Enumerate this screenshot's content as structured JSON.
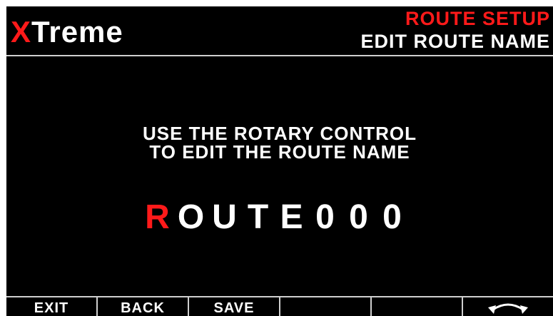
{
  "header": {
    "logo_first": "X",
    "logo_rest": "Treme",
    "category": "ROUTE SETUP",
    "title": "EDIT ROUTE NAME"
  },
  "instructions": {
    "line1": "USE THE ROTARY CONTROL",
    "line2": "TO EDIT THE ROUTE NAME"
  },
  "route_name": {
    "chars": [
      "R",
      "O",
      "U",
      "T",
      "E",
      "0",
      "0",
      "0"
    ],
    "cursor_index": 0
  },
  "softkeys": [
    {
      "label": "EXIT"
    },
    {
      "label": "BACK"
    },
    {
      "label": "SAVE"
    },
    {
      "label": ""
    },
    {
      "label": ""
    },
    {
      "label": "",
      "icon": "rotary-arrows-icon"
    }
  ],
  "colors": {
    "accent": "#ff1a1a",
    "background": "#000000",
    "text": "#ffffff",
    "divider": "#cfcfcf"
  }
}
